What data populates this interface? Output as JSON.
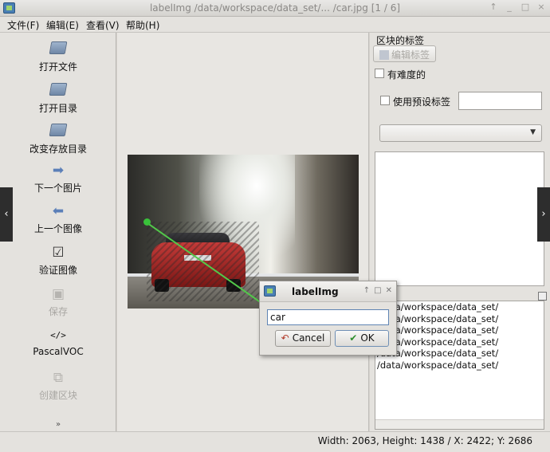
{
  "window": {
    "title": "labelImg /data/workspace/data_set/... /car.jpg [1 / 6]",
    "buttons": [
      "↑",
      "_",
      "□",
      "×"
    ]
  },
  "menu": [
    "文件(F)",
    "编辑(E)",
    "查看(V)",
    "帮助(H)"
  ],
  "toolbar": [
    {
      "label": "打开文件",
      "icon": "open-file-icon",
      "enabled": true
    },
    {
      "label": "打开目录",
      "icon": "open-dir-icon",
      "enabled": true
    },
    {
      "label": "改变存放目录",
      "icon": "change-save-dir-icon",
      "enabled": true
    },
    {
      "label": "下一个图片",
      "icon": "next-image-icon",
      "enabled": true
    },
    {
      "label": "上一个图像",
      "icon": "prev-image-icon",
      "enabled": true
    },
    {
      "label": "验证图像",
      "icon": "verify-image-icon",
      "enabled": true
    },
    {
      "label": "保存",
      "icon": "save-icon",
      "enabled": false
    },
    {
      "label": "PascalVOC",
      "icon": "format-icon",
      "icon_text": "</>",
      "enabled": true
    },
    {
      "label": "创建区块",
      "icon": "create-box-icon",
      "enabled": false
    }
  ],
  "labels_panel": {
    "title": "区块的标签",
    "edit_label_button": "编辑标签",
    "difficult_checkbox": "有难度的",
    "use_default_label_checkbox": "使用预设标签"
  },
  "file_list": {
    "title": "列表",
    "items": [
      "/data/workspace/data_set/",
      "/data/workspace/data_set/",
      "/data/workspace/data_set/",
      "/data/workspace/data_set/",
      "/data/workspace/data_set/",
      "/data/workspace/data_set/"
    ]
  },
  "dialog": {
    "title": "labelImg",
    "input_value": "car",
    "cancel_label": "Cancel",
    "ok_label": "OK"
  },
  "status": "Width: 2063, Height: 1438 / X: 2422; Y: 2686",
  "nav_arrows": {
    "left": "‹",
    "right": "›"
  }
}
